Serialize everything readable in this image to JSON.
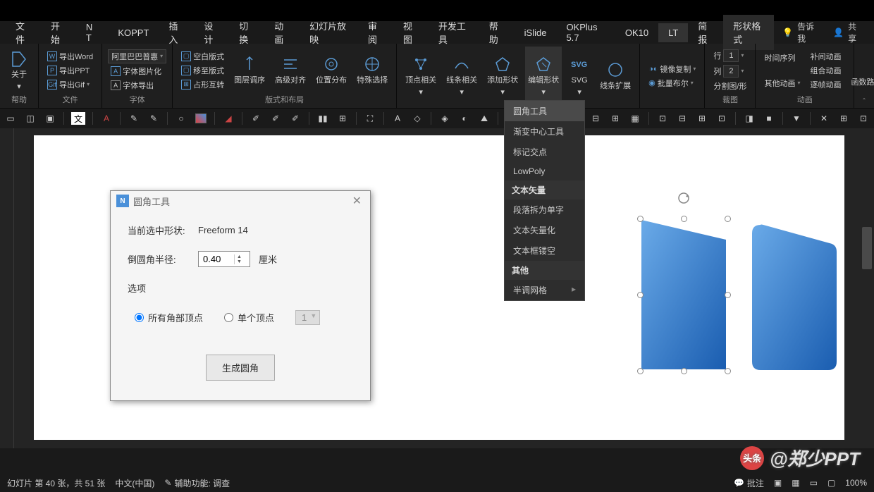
{
  "tabs": {
    "file": "文件",
    "start": "开始",
    "nt": "N T",
    "koppt": "KOPPT",
    "insert": "插入",
    "design": "设计",
    "transition": "切换",
    "anim": "动画",
    "slideshow": "幻灯片放映",
    "review": "审阅",
    "view": "视图",
    "dev": "开发工具",
    "help": "帮助",
    "islide": "iSlide",
    "okplus": "OKPlus 5.7",
    "ok10": "OK10",
    "lt": "LT",
    "briefing": "简报",
    "shapefmt": "形状格式",
    "tellme": "告诉我",
    "share": "共享"
  },
  "ribbon": {
    "about": "关于",
    "help_grp": "帮助",
    "export_word": "导出Word",
    "export_ppt": "导出PPT",
    "export_gif": "导出Gif",
    "file_grp": "文件",
    "font_sel": "阿里巴巴普惠",
    "font_pic": "字体图片化",
    "font_export": "字体导出",
    "font_grp": "字体",
    "blank": "空白版式",
    "move": "移至版式",
    "placeholder": "占形互转",
    "layer": "图层调序",
    "contrast": "高级对齐",
    "distribute": "位置分布",
    "special": "特殊选择",
    "layout_grp": "版式和布局",
    "vertex": "顶点相关",
    "line": "线条相关",
    "addshape": "添加形状",
    "editshape": "编辑形状",
    "svg": "SVG",
    "lineext": "线条扩展",
    "mirror": "镜像复制",
    "bool": "批量布尔",
    "row": "行",
    "col": "列",
    "row_v": "1",
    "col_v": "2",
    "split": "分割图/形",
    "crop_grp": "裁图",
    "timeline": "时间序列",
    "supp": "补间动画",
    "group": "组合动画",
    "frame": "逐帧动画",
    "other": "其他动画",
    "func": "函数路径",
    "anim_grp": "动画"
  },
  "dropdown": {
    "round": "圆角工具",
    "gradient": "渐变中心工具",
    "mark": "标记交点",
    "lowpoly": "LowPoly",
    "sec_text": "文本矢量",
    "para": "段落拆为单字",
    "vector": "文本矢量化",
    "hollow": "文本框镂空",
    "sec_other": "其他",
    "halftone": "半调网格"
  },
  "dialog": {
    "title": "圆角工具",
    "cur_label": "当前选中形状:",
    "cur_val": "Freeform 14",
    "radius_label": "倒圆角半径:",
    "radius_val": "0.40",
    "radius_unit": "厘米",
    "opts_label": "选项",
    "opt_all": "所有角部顶点",
    "opt_single": "单个顶点",
    "single_val": "1",
    "btn": "生成圆角"
  },
  "status": {
    "slide": "幻灯片 第 40 张，共 51 张",
    "lang": "中文(中国)",
    "access": "辅助功能: 调查",
    "comment": "批注",
    "zoom": "100%"
  },
  "watermark": {
    "badge": "头条",
    "text": "@郑少PPT"
  }
}
